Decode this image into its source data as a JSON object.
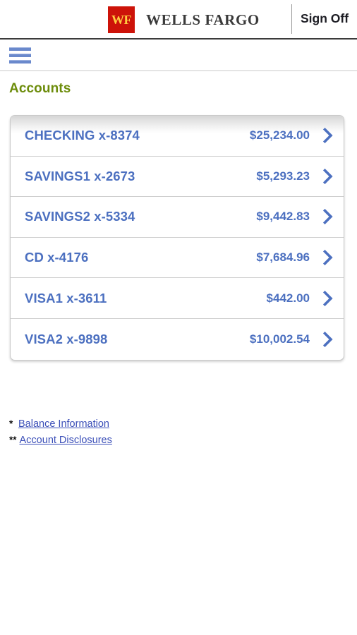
{
  "header": {
    "logo_mark_text": "WF",
    "logo_wordmark": "WELLS FARGO",
    "sign_off_label": "Sign Off",
    "brand_red": "#cd1309",
    "brand_gold": "#ffcd41"
  },
  "nav": {
    "menu_icon": "hamburger-menu-icon",
    "bar_color": "#6a89cc"
  },
  "main": {
    "page_title": "Accounts",
    "title_color": "#6c8c0a",
    "link_color": "#4c70c0",
    "accounts": [
      {
        "name": "CHECKING x-8374",
        "balance": "$25,234.00",
        "chevron": "chevron-right-icon"
      },
      {
        "name": "SAVINGS1 x-2673",
        "balance": "$5,293.23",
        "chevron": "chevron-right-icon"
      },
      {
        "name": "SAVINGS2 x-5334",
        "balance": "$9,442.83",
        "chevron": "chevron-right-icon"
      },
      {
        "name": "CD x-4176",
        "balance": "$7,684.96",
        "chevron": "chevron-right-icon"
      },
      {
        "name": "VISA1 x-3611",
        "balance": "$442.00",
        "chevron": "chevron-right-icon"
      },
      {
        "name": "VISA2 x-9898",
        "balance": "$10,002.54",
        "chevron": "chevron-right-icon"
      }
    ]
  },
  "footnotes": [
    {
      "mark": "*",
      "label": "Balance Information"
    },
    {
      "mark": "**",
      "label": "Account Disclosures"
    }
  ]
}
